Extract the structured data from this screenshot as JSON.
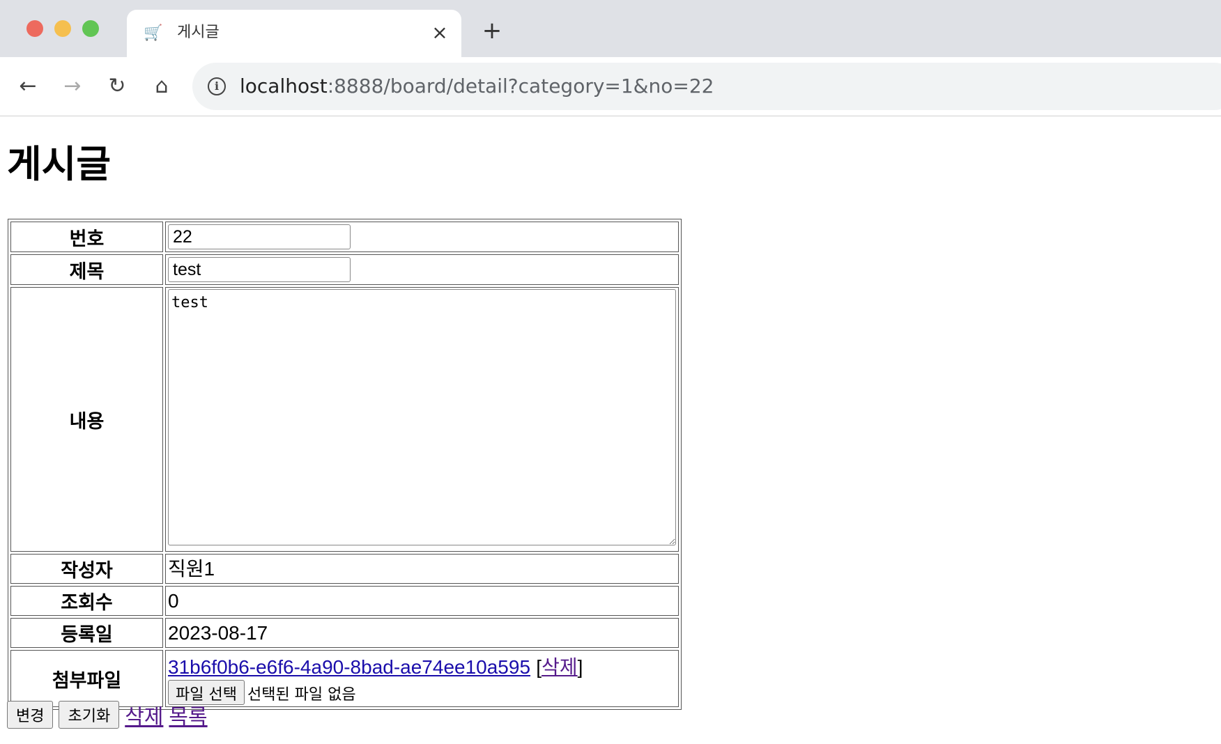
{
  "browser": {
    "tab_title": "게시글",
    "tab_favicon": "cart-icon",
    "url_host": "localhost",
    "url_rest": ":8888/board/detail?category=1&no=22"
  },
  "page": {
    "heading": "게시글"
  },
  "form": {
    "labels": {
      "no": "번호",
      "title": "제목",
      "content": "내용",
      "writer": "작성자",
      "views": "조회수",
      "date": "등록일",
      "file": "첨부파일"
    },
    "values": {
      "no": "22",
      "title": "test",
      "content": "test",
      "writer": "직원1",
      "views": "0",
      "date": "2023-08-17"
    },
    "attachment": {
      "filename": "31b6f0b6-e6f6-4a90-8bad-ae74ee10a595",
      "bracket_open": "[",
      "delete_label": "삭제",
      "bracket_close": "]",
      "choose_button": "파일 선택",
      "no_file_text": "선택된 파일 없음"
    }
  },
  "actions": {
    "change": "변경",
    "reset": "초기화",
    "delete": "삭제",
    "list": "목록"
  }
}
